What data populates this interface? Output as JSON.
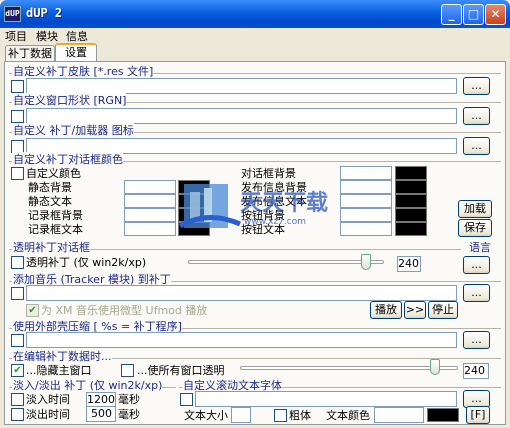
{
  "window": {
    "title": "dUP 2",
    "icon_text": "dUP"
  },
  "menu": [
    "项目",
    "模块",
    "信息"
  ],
  "tabs": [
    "补丁数据",
    "设置"
  ],
  "skin": {
    "header": "自定义补丁皮肤 [*.res 文件]",
    "browse": "..."
  },
  "shape": {
    "header": "自定义窗口形状 [RGN]",
    "browse": "..."
  },
  "icon_group": {
    "header": "自定义 补丁/加载器 图标",
    "browse": "..."
  },
  "dialog_colors": {
    "header": "自定义补丁对话框颜色",
    "custom_label": "自定义颜色",
    "left_rows": [
      "静态背景",
      "静态文本",
      "记录框背景",
      "记录框文本"
    ],
    "right_rows": [
      "对话框背景",
      "发布信息背景",
      "发布信息文本",
      "按钮背景",
      "按钮文本"
    ],
    "load_button": "加载",
    "save_button": "保存"
  },
  "transparent": {
    "header": "透明补丁对话框",
    "label": "透明补丁 (仅 win2k/xp)",
    "value": "240"
  },
  "language": {
    "header": "语言",
    "browse": "..."
  },
  "music": {
    "header": "添加音乐 (Tracker 模块) 到补丁",
    "browse": "...",
    "sub_label": "为 XM 音乐使用微型 Ufmod 播放",
    "play": "播放",
    "skip": ">>",
    "stop": "停止"
  },
  "packer": {
    "header": "使用外部壳压缩 [ %s = 补丁程序]",
    "browse": "..."
  },
  "editing": {
    "header": "在编辑补丁数据时...",
    "hide_main": "...隐藏主窗口",
    "make_transparent": "...使所有窗口透明",
    "value": "240"
  },
  "fade": {
    "header": "淡入/淡出 补丁 (仅 win2k/xp)",
    "fade_in": "淡入时间",
    "fade_in_value": "1200",
    "fade_out": "淡出时间",
    "fade_out_value": "500",
    "unit": "毫秒"
  },
  "scroll_font": {
    "header": "自定义滚动文本字体",
    "browse": "...",
    "size_label": "文本大小",
    "bold_label": "粗体",
    "color_label": "文本颜色",
    "font_button": "[F]"
  },
  "watermark": {
    "text": "天天下载",
    "url": "www.xz7.com"
  }
}
